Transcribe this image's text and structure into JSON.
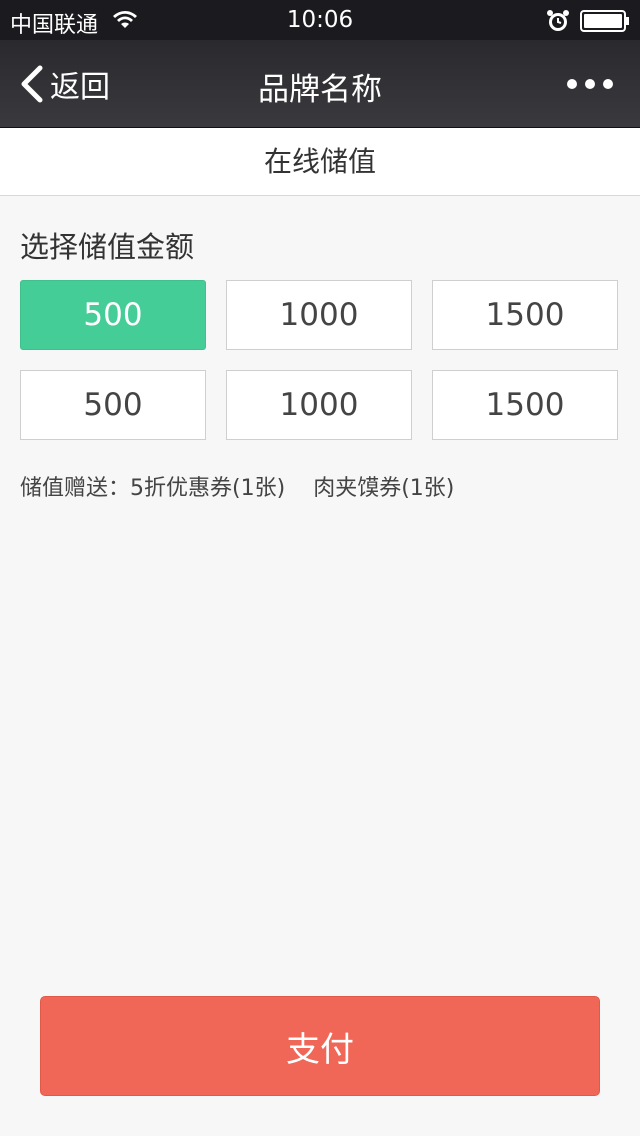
{
  "status_bar": {
    "carrier": "中国联通",
    "time": "10:06",
    "wifi_icon": "wifi-icon",
    "alarm_icon": "alarm-icon",
    "battery_icon": "battery-icon"
  },
  "nav": {
    "back_label": "返回",
    "title": "品牌名称",
    "more_icon": "more-dots-icon"
  },
  "sub_header": {
    "title": "在线储值"
  },
  "amount_section": {
    "label": "选择储值金额",
    "options": [
      {
        "value": "500",
        "selected": true
      },
      {
        "value": "1000",
        "selected": false
      },
      {
        "value": "1500",
        "selected": false
      },
      {
        "value": "500",
        "selected": false
      },
      {
        "value": "1000",
        "selected": false
      },
      {
        "value": "1500",
        "selected": false
      }
    ]
  },
  "bonus": {
    "prefix": "储值赠送：",
    "items": [
      "5折优惠券(1张)",
      "肉夹馍券(1张)"
    ]
  },
  "pay_button": {
    "label": "支付"
  },
  "colors": {
    "selected": "#45cd98",
    "pay": "#f06757",
    "nav_bg": "#2a2a2e"
  }
}
